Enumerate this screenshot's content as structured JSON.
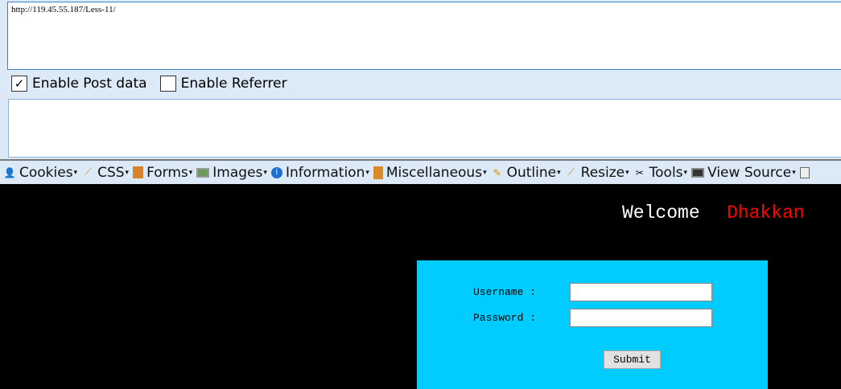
{
  "hackbar": {
    "url": "http://119.45.55.187/Less-11/",
    "post_data": "",
    "enable_post": {
      "label": "Enable Post data",
      "checked": true
    },
    "enable_referrer": {
      "label": "Enable Referrer",
      "checked": false
    }
  },
  "toolbar": [
    {
      "label": "Cookies",
      "icon": "user-icon"
    },
    {
      "label": "CSS",
      "icon": "wand-icon"
    },
    {
      "label": "Forms",
      "icon": "clipboard-icon"
    },
    {
      "label": "Images",
      "icon": "image-icon"
    },
    {
      "label": "Information",
      "icon": "info-icon"
    },
    {
      "label": "Miscellaneous",
      "icon": "book-icon"
    },
    {
      "label": "Outline",
      "icon": "pencil-icon"
    },
    {
      "label": "Resize",
      "icon": "ruler-icon"
    },
    {
      "label": "Tools",
      "icon": "tools-icon"
    },
    {
      "label": "View Source",
      "icon": "monitor-icon"
    }
  ],
  "page": {
    "welcome": "Welcome",
    "name": "Dhakkan",
    "username_label": "Username :",
    "password_label": "Password :",
    "submit": "Submit",
    "colors": {
      "panel": "#00ccff",
      "name": "#ff0000"
    }
  }
}
